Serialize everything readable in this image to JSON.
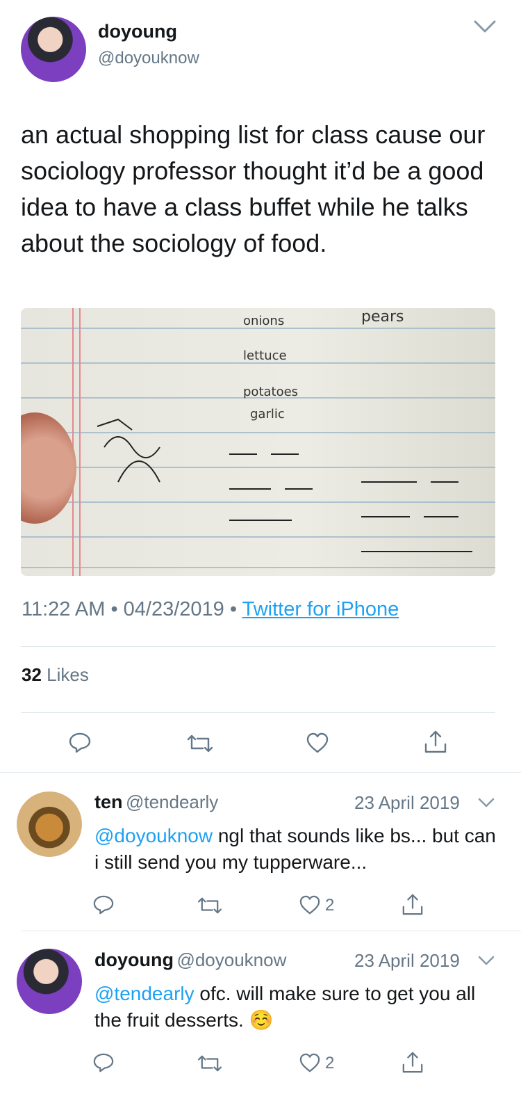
{
  "tweet": {
    "author_name": "doyoung",
    "author_handle": "@doyouknow",
    "text": "an actual shopping list for class cause our sociology professor thought it’d be a good idea to have a class buffet while he talks about the sociology of food.",
    "time": "11:22 AM",
    "date": "04/23/2019",
    "separator": "•",
    "source": "Twitter for iPhone",
    "likes_count": "32",
    "likes_label": "Likes",
    "image": {
      "handwriting": [
        "onions",
        "pears",
        "lettuce",
        "potatoes",
        "garlic"
      ]
    }
  },
  "replies": [
    {
      "name": "ten",
      "handle": "@tendearly",
      "date": "23 April 2019",
      "mention": "@doyouknow",
      "text": " ngl that sounds like bs... but can i still send you my tupperware...",
      "likes": "2"
    },
    {
      "name": "doyoung",
      "handle": "@doyouknow",
      "date": "23 April 2019",
      "mention": "@tendearly",
      "text": " ofc. will make sure to get you all the fruit desserts. ☺️",
      "likes": "2"
    }
  ],
  "icons": {
    "reply": "reply-icon",
    "retweet": "retweet-icon",
    "like": "heart-icon",
    "share": "share-icon",
    "menu": "chevron-down-icon"
  },
  "colors": {
    "accent": "#1da1f2",
    "muted": "#657786",
    "text": "#14171a",
    "divider": "#e1e8ed"
  }
}
